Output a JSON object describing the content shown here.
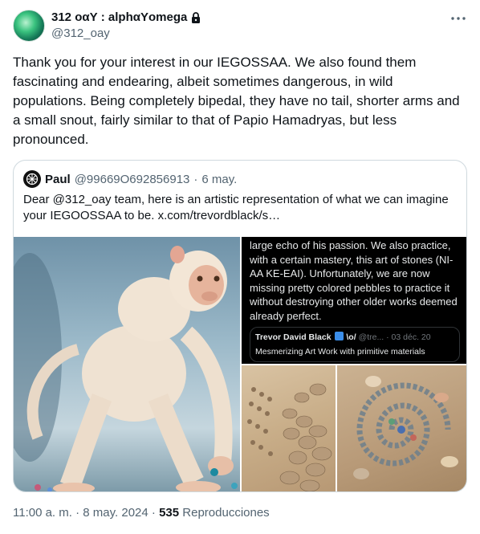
{
  "author": {
    "display_name": "312 οαΥ : alphαΥomega",
    "handle": "@312_oay"
  },
  "tweet": {
    "text": "Thank you for your interest in our IEGOSSAA. We also found them fascinating and endearing, albeit sometimes dangerous, in wild populations. Being completely bipedal, they have no tail, shorter arms and a small snout, fairly similar to that of Papio Hamadryas, but less pronounced."
  },
  "quote": {
    "name": "Paul",
    "handle": "@99669O692856913",
    "separator": "·",
    "date": "6 may.",
    "text": "Dear @312_oay team, here is an artistic representation of what we can imagine your IEGOOSSAA to be.  x.com/trevordblack/s…",
    "embedded_screenshot": {
      "text": "large echo of his passion. We also practice, with a certain mastery, this art of stones (NI-AA KE-EAI). Unfortunately, we are now missing pretty colored pebbles to practice it without destroying other older works deemed already perfect.",
      "card_author": "Trevor David Black",
      "card_author_suffix": "\\o/",
      "card_meta": "@tre... · 03 déc. 20",
      "card_text": "Mesmerizing Art Work with primitive materials"
    }
  },
  "footer": {
    "time": "11:00 a. m.",
    "separator1": " · ",
    "date": "8 may. 2024",
    "separator2": " · ",
    "views": "535",
    "views_label": " Reproducciones"
  },
  "colors": {
    "text_primary": "#0f1419",
    "text_secondary": "#536471",
    "border": "#cfd9de"
  },
  "icons": {
    "lock": "lock-icon",
    "more": "more-icon"
  }
}
